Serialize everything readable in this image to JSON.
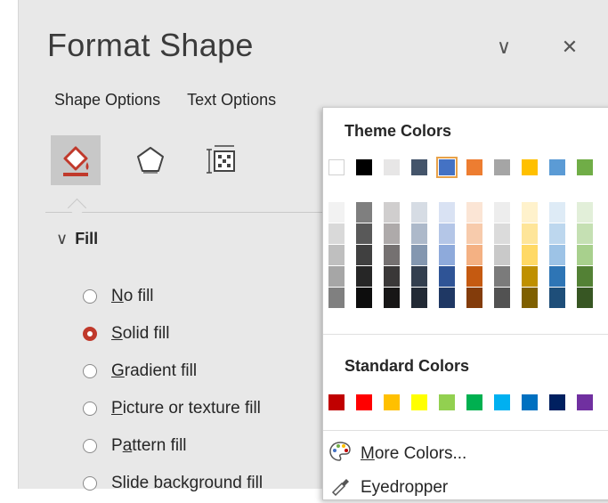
{
  "pane": {
    "title": "Format Shape",
    "collapse_glyph": "∨",
    "close_glyph": "✕",
    "tabs": [
      "Shape Options",
      "Text Options"
    ],
    "icons": [
      "fill-line-icon",
      "effects-icon",
      "size-properties-icon"
    ],
    "section": {
      "chevron": "∨",
      "label": "Fill"
    },
    "fill_options": [
      {
        "key": "N",
        "rest": "o fill",
        "checked": false
      },
      {
        "key": "S",
        "rest": "olid fill",
        "checked": true
      },
      {
        "key": "G",
        "rest": "radient fill",
        "checked": false
      },
      {
        "key": "P",
        "rest": "icture or texture fill",
        "checked": false
      },
      {
        "key": "P",
        "rest": "attern fill",
        "checked": false,
        "pre": "P",
        "post": "ttern fill",
        "under": "a"
      },
      {
        "key": "",
        "rest": "Slide background fill",
        "checked": false
      }
    ]
  },
  "picker": {
    "theme_heading": "Theme Colors",
    "standard_heading": "Standard Colors",
    "theme_colors": [
      "#ffffff",
      "#000000",
      "#e7e6e6",
      "#44546a",
      "#4472c4",
      "#ed7d31",
      "#a5a5a5",
      "#ffc000",
      "#5b9bd5",
      "#70ad47"
    ],
    "selected_theme_index": 4,
    "shades": [
      [
        "#f2f2f2",
        "#d9d9d9",
        "#bfbfbf",
        "#a6a6a6",
        "#808080"
      ],
      [
        "#7f7f7f",
        "#595959",
        "#404040",
        "#262626",
        "#0d0d0d"
      ],
      [
        "#d0cece",
        "#aeaaaa",
        "#757171",
        "#3a3838",
        "#171616"
      ],
      [
        "#d6dce4",
        "#adb9ca",
        "#8497b0",
        "#333f4f",
        "#222a35"
      ],
      [
        "#d9e2f3",
        "#b4c6e7",
        "#8eaadb",
        "#2f5496",
        "#1f3864"
      ],
      [
        "#fbe5d5",
        "#f7cbac",
        "#f4b183",
        "#c55a11",
        "#833c0b"
      ],
      [
        "#ededed",
        "#dbdbdb",
        "#c9c9c9",
        "#7b7b7b",
        "#525252"
      ],
      [
        "#fff2cc",
        "#fee599",
        "#ffd965",
        "#bf9000",
        "#7f6000"
      ],
      [
        "#deebf6",
        "#bdd7ee",
        "#9dc3e6",
        "#2e75b5",
        "#1e4e79"
      ],
      [
        "#e2efd9",
        "#c5e0b3",
        "#a8d08d",
        "#538135",
        "#375623"
      ]
    ],
    "standard_colors": [
      "#c00000",
      "#ff0000",
      "#ffc000",
      "#ffff00",
      "#92d050",
      "#00b050",
      "#00b0f0",
      "#0070c0",
      "#002060",
      "#7030a0"
    ],
    "more_colors_label": "ore Colors...",
    "more_colors_key": "M",
    "eyedropper_label": "Eyedropper"
  }
}
